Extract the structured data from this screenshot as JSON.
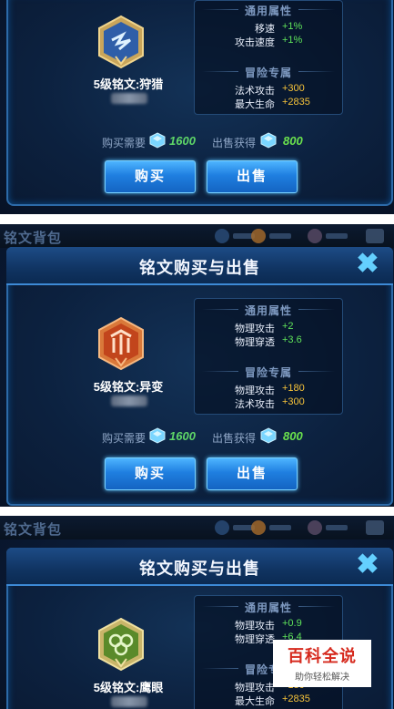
{
  "bag_title": "铭文背包",
  "dialog_title": "铭文购买与出售",
  "close_glyph": "✖",
  "common_attr_label": "通用属性",
  "adventure_attr_label": "冒险专属",
  "buy_cost_label": "购买需要",
  "sell_gain_label": "出售获得",
  "buy_button": "购买",
  "sell_button": "出售",
  "panels": [
    {
      "name": "5级铭文:狩猎",
      "emblem_color": "#2f5ea8",
      "common": [
        {
          "label": "移速",
          "value": "+1%"
        },
        {
          "label": "攻击速度",
          "value": "+1%"
        }
      ],
      "adventure": [
        {
          "label": "法术攻击",
          "value": "+300"
        },
        {
          "label": "最大生命",
          "value": "+2835"
        }
      ],
      "buy_price": "1600",
      "sell_price": "800"
    },
    {
      "name": "5级铭文:异变",
      "emblem_color": "#c2451c",
      "common": [
        {
          "label": "物理攻击",
          "value": "+2"
        },
        {
          "label": "物理穿透",
          "value": "+3.6"
        }
      ],
      "adventure": [
        {
          "label": "物理攻击",
          "value": "+180"
        },
        {
          "label": "法术攻击",
          "value": "+300"
        }
      ],
      "buy_price": "1600",
      "sell_price": "800"
    },
    {
      "name": "5级铭文:鹰眼",
      "emblem_color": "#5a8a2a",
      "common": [
        {
          "label": "物理攻击",
          "value": "+0.9"
        },
        {
          "label": "物理穿透",
          "value": "+6.4"
        }
      ],
      "adventure": [
        {
          "label": "物理攻击",
          "value": "+180"
        },
        {
          "label": "最大生命",
          "value": "+2835"
        }
      ]
    }
  ],
  "watermark": {
    "brand": "百科全说",
    "slogan": "助你轻松解决"
  },
  "icons": {
    "crystal": "blue-crystal-icon",
    "close": "close-icon"
  }
}
